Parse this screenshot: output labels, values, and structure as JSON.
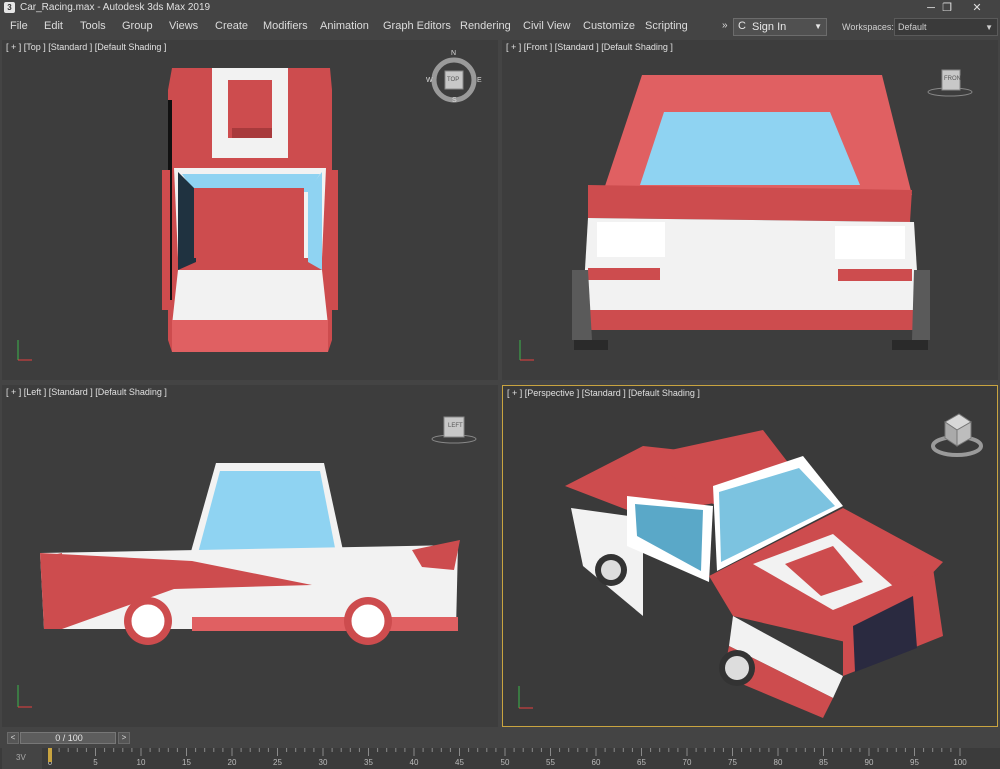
{
  "window": {
    "title": "Car_Racing.max - Autodesk 3ds Max 2019",
    "minimize_glyph": "─",
    "maximize_glyph": "❐",
    "close_glyph": "✕"
  },
  "menu": {
    "items": [
      "File",
      "Edit",
      "Tools",
      "Group",
      "Views",
      "Create",
      "Modifiers",
      "Animation",
      "Graph Editors",
      "Rendering",
      "Civil View",
      "Customize",
      "Scripting"
    ],
    "overflow_glyph": "»"
  },
  "account": {
    "sign_in_label": "Sign In",
    "icon": "user-icon",
    "icon_glyph": "C"
  },
  "workspace": {
    "label": "Workspaces:",
    "value": "Default"
  },
  "viewports": {
    "top": {
      "label": "[ + ] [Top ] [Standard ] [Default Shading ]",
      "viewcube": "TOP",
      "compass": [
        "N",
        "S",
        "W",
        "E"
      ]
    },
    "front": {
      "label": "[ + ] [Front ] [Standard ] [Default Shading ]",
      "viewcube": "FRON"
    },
    "left": {
      "label": "[ + ] [Left ] [Standard ] [Default Shading ]",
      "viewcube": "LEFT"
    },
    "perspective": {
      "label": "[ + ] [Perspective ] [Standard ] [Default Shading ]"
    }
  },
  "timeline": {
    "frame_display": "0 / 100",
    "ticks": [
      "0",
      "5",
      "10",
      "15",
      "20",
      "25",
      "30",
      "35",
      "40",
      "45",
      "50",
      "55",
      "60",
      "65",
      "70",
      "75",
      "80",
      "85",
      "90",
      "95",
      "100"
    ],
    "corner_label": "3V"
  },
  "colors": {
    "car_red": "#cd4c4e",
    "car_white": "#f2f2f2",
    "glass": "#8fd3f2",
    "viewport_bg": "#3d3d3d",
    "active_border": "#c9a440"
  }
}
